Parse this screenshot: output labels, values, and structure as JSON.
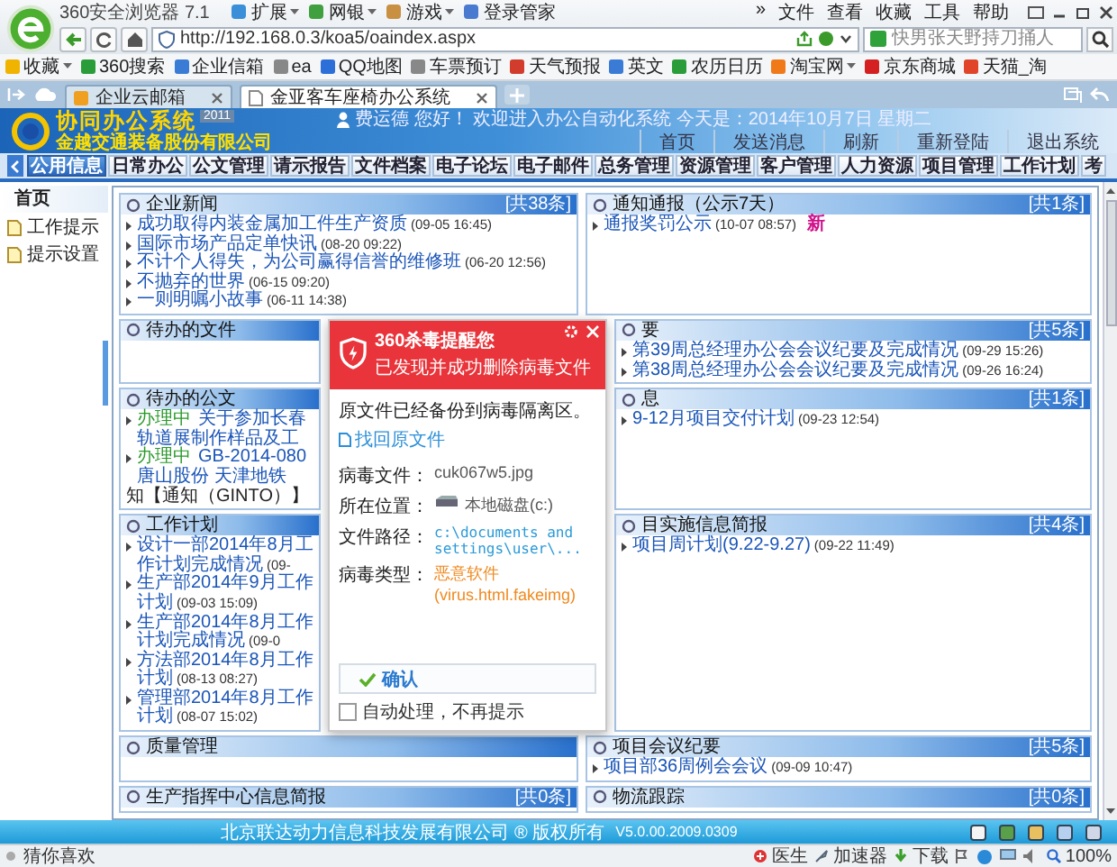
{
  "browser": {
    "title": "360安全浏览器 7.1",
    "menu": [
      "»",
      "文件",
      "查看",
      "收藏",
      "工具",
      "帮助"
    ],
    "url": "http://192.168.0.3/koa5/oaindex.aspx",
    "search": {
      "placeholder": "快男张天野持刀捅人"
    },
    "bookmarks": [
      {
        "label": "收藏",
        "kind": "menu"
      },
      {
        "label": "360搜索",
        "kind": "link"
      },
      {
        "label": "企业信箱",
        "kind": "link"
      },
      {
        "label": "ea",
        "kind": "link"
      },
      {
        "label": "QQ地图",
        "kind": "link"
      },
      {
        "label": "车票预订",
        "kind": "link"
      },
      {
        "label": "天气预报",
        "kind": "link"
      },
      {
        "label": "英文",
        "kind": "link"
      },
      {
        "label": "农历日历",
        "kind": "link"
      },
      {
        "label": "淘宝网",
        "kind": "menu"
      },
      {
        "label": "京东商城",
        "kind": "link"
      },
      {
        "label": "天猫_淘",
        "kind": "link"
      }
    ],
    "tools": [
      {
        "label": "扩展",
        "kind": "menu"
      },
      {
        "label": "网银",
        "kind": "menu"
      },
      {
        "label": "游戏",
        "kind": "menu"
      },
      {
        "label": "登录管家",
        "kind": "link"
      }
    ],
    "tabs": [
      {
        "label": "企业云邮箱",
        "selected": false
      },
      {
        "label": "金亚客车座椅办公系统",
        "selected": true
      }
    ]
  },
  "app": {
    "logo_title": "协同办公系统",
    "logo_year": "2011",
    "company": "金越交通装备股份有限公司",
    "greeting": "费运德 您好！ 欢迎进入办公自动化系统 今天是：2014年10月7日 星期二",
    "links": [
      "首页",
      "发送消息",
      "刷新",
      "重新登陆",
      "退出系统"
    ],
    "nav": [
      {
        "label": "公用信息",
        "selected": true
      },
      {
        "label": "日常办公",
        "selected": false
      },
      {
        "label": "公文管理",
        "selected": false
      },
      {
        "label": "请示报告",
        "selected": false
      },
      {
        "label": "文件档案",
        "selected": false
      },
      {
        "label": "电子论坛",
        "selected": false
      },
      {
        "label": "电子邮件",
        "selected": false
      },
      {
        "label": "总务管理",
        "selected": false
      },
      {
        "label": "资源管理",
        "selected": false
      },
      {
        "label": "客户管理",
        "selected": false
      },
      {
        "label": "人力资源",
        "selected": false
      },
      {
        "label": "项目管理",
        "selected": false
      },
      {
        "label": "工作计划",
        "selected": false
      },
      {
        "label": "考",
        "selected": false
      }
    ]
  },
  "sidebar": {
    "heading": "首页",
    "items": [
      "工作提示",
      "提示设置"
    ]
  },
  "left_panels": [
    {
      "title": "企业新闻",
      "count": "[共38条]",
      "items": [
        {
          "title": "成功取得内装金属加工件生产资质",
          "date": "(09-05 16:45)"
        },
        {
          "title": "国际市场产品定单快讯",
          "date": "(08-20 09:22)"
        },
        {
          "title": "不计个人得失，为公司赢得信誉的维修班",
          "date": "(06-20 12:56)"
        },
        {
          "title": "不抛弃的世界",
          "date": "(06-15 09:20)"
        },
        {
          "title": "一则明嘱小故事",
          "date": "(06-11 14:38)"
        }
      ]
    },
    {
      "title": "待办的文件"
    },
    {
      "title": "待办的公文",
      "items": [
        {
          "kind": "item",
          "status": "办理中",
          "title": "关于参加长春轨道展制作样品及工"
        },
        {
          "kind": "item",
          "status": "办理中",
          "title": "GB-2014-080 唐山股份 天津地铁"
        },
        {
          "kind": "continuation",
          "title": "知【通知（GINTO）】"
        }
      ]
    },
    {
      "title": "工作计划",
      "items": [
        {
          "title": "设计一部2014年8月工作计划完成情况",
          "date": "(09-"
        },
        {
          "title": "生产部2014年9月工作计划",
          "date": "(09-03 15:09)"
        },
        {
          "title": "生产部2014年8月工作计划完成情况",
          "date": "(09-0"
        },
        {
          "title": "方法部2014年8月工作计划",
          "date": "(08-13 08:27)"
        },
        {
          "title": "管理部2014年8月工作计划",
          "date": "(08-07 15:02)"
        }
      ]
    },
    {
      "title": "质量管理"
    },
    {
      "title": "生产指挥中心信息简报",
      "count": "[共0条]"
    }
  ],
  "right_panels": [
    {
      "title": "通知通报（公示7天）",
      "count": "[共1条]",
      "items": [
        {
          "title": "通报奖罚公示",
          "date": "(10-07 08:57)",
          "badge": "新"
        }
      ]
    },
    {
      "title": "要",
      "count": "[共5条]",
      "items": [
        {
          "title": "第39周总经理办公会会议纪要及完成情况",
          "date": "(09-29 15:26)"
        },
        {
          "title": "第38周总经理办公会会议纪要及完成情况",
          "date": "(09-26 16:24)"
        }
      ]
    },
    {
      "title": "息",
      "count": "[共1条]",
      "items": [
        {
          "title": "9-12月项目交付计划",
          "date": "(09-23 12:54)"
        }
      ]
    },
    {
      "title": "目实施信息简报",
      "count": "[共4条]",
      "items": [
        {
          "title": "项目周计划(9.22-9.27)",
          "date": "(09-22 11:49)"
        }
      ]
    },
    {
      "title": "项目会议纪要",
      "count": "[共5条]",
      "items": [
        {
          "title": "项目部36周例会会议",
          "date": "(09-09 10:47)"
        }
      ]
    },
    {
      "title": "物流跟踪",
      "count": "[共0条]"
    }
  ],
  "popup": {
    "caption": "360杀毒提醒您",
    "title": "已发现并成功删除病毒文件",
    "note": "原文件已经备份到病毒隔离区。",
    "restore_link": "找回原文件",
    "fields": [
      {
        "label": "病毒文件：",
        "value": "cuk067w5.jpg",
        "kind": "plain"
      },
      {
        "label": "所在位置：",
        "value": "本地磁盘(c:)",
        "kind": "disk"
      },
      {
        "label": "文件路径：",
        "value": "c:\\documents and settings\\user\\...",
        "kind": "path"
      },
      {
        "label": "病毒类型：",
        "value": "恶意软件(virus.html.fakeimg)",
        "kind": "warning"
      }
    ],
    "confirm": "确认",
    "auto": {
      "label": "自动处理，不再提示",
      "checked": false
    }
  },
  "footer": {
    "copyright": "北京联达动力信息科技发展有限公司 ® 版权所有",
    "version": "V5.0.00.2009.0309"
  },
  "status_bar": {
    "left": "猜你喜欢",
    "items": [
      "医生",
      "加速器",
      "下载"
    ],
    "zoom": "100%"
  }
}
